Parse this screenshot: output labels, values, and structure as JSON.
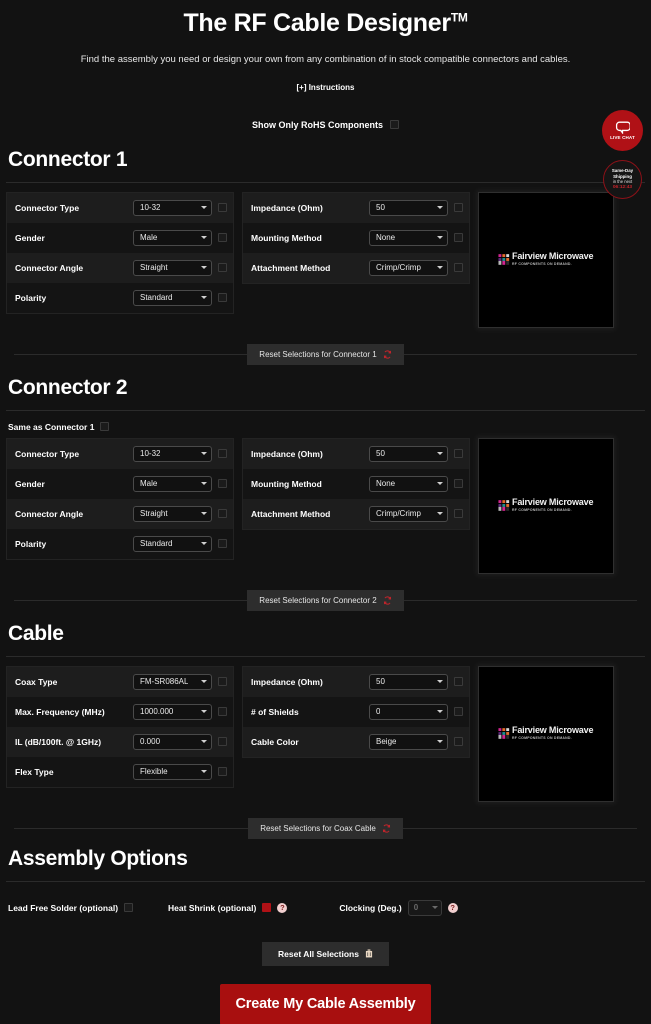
{
  "header": {
    "title": "The RF Cable Designer",
    "trademark": "TM",
    "subtitle": "Find the assembly you need or design your own from any combination of in stock compatible connectors and cables.",
    "instructions_link": "[+] Instructions",
    "rohs_label": "Show Only RoHS Components"
  },
  "widgets": {
    "live_chat_label": "LIVE CHAT",
    "ship_line1": "Same-Day",
    "ship_line2": "Shipping",
    "ship_line3": "in the next",
    "ship_timer": "06:12:43"
  },
  "logo": {
    "name": "Fairview Microwave",
    "tagline": "RF COMPONENTS ON DEMAND."
  },
  "connector1": {
    "title": "Connector 1",
    "left_rows": [
      {
        "label": "Connector Type",
        "value": "10-32"
      },
      {
        "label": "Gender",
        "value": "Male"
      },
      {
        "label": "Connector Angle",
        "value": "Straight"
      },
      {
        "label": "Polarity",
        "value": "Standard"
      }
    ],
    "right_rows": [
      {
        "label": "Impedance (Ohm)",
        "value": "50"
      },
      {
        "label": "Mounting Method",
        "value": "None"
      },
      {
        "label": "Attachment Method",
        "value": "Crimp/Crimp"
      }
    ],
    "reset_label": "Reset Selections for Connector 1"
  },
  "connector2": {
    "title": "Connector 2",
    "same_as_label": "Same as Connector 1",
    "left_rows": [
      {
        "label": "Connector Type",
        "value": "10-32"
      },
      {
        "label": "Gender",
        "value": "Male"
      },
      {
        "label": "Connector Angle",
        "value": "Straight"
      },
      {
        "label": "Polarity",
        "value": "Standard"
      }
    ],
    "right_rows": [
      {
        "label": "Impedance (Ohm)",
        "value": "50"
      },
      {
        "label": "Mounting Method",
        "value": "None"
      },
      {
        "label": "Attachment Method",
        "value": "Crimp/Crimp"
      }
    ],
    "reset_label": "Reset Selections for Connector 2"
  },
  "cable": {
    "title": "Cable",
    "left_rows": [
      {
        "label": "Coax Type",
        "value": "FM-SR086AL"
      },
      {
        "label": "Max. Frequency (MHz)",
        "value": "1000.000"
      },
      {
        "label": "IL (dB/100ft. @ 1GHz)",
        "value": "0.000"
      },
      {
        "label": "Flex Type",
        "value": "Flexible"
      }
    ],
    "right_rows": [
      {
        "label": "Impedance (Ohm)",
        "value": "50"
      },
      {
        "label": "# of Shields",
        "value": "0"
      },
      {
        "label": "Cable Color",
        "value": "Beige"
      }
    ],
    "reset_label": "Reset Selections for Coax Cable"
  },
  "assembly": {
    "title": "Assembly Options",
    "lead_free_label": "Lead Free Solder (optional)",
    "heat_shrink_label": "Heat Shrink (optional)",
    "clocking_label": "Clocking (Deg.)",
    "clocking_value": "0",
    "help_glyph": "?",
    "reset_all_label": "Reset All Selections",
    "cta_label": "Create My Cable Assembly"
  },
  "colors": {
    "brand_red": "#b01116",
    "cta_red": "#a80f0f",
    "page_bg": "#121212",
    "row_alt": "#1d1d1d",
    "row_base": "#141414"
  }
}
